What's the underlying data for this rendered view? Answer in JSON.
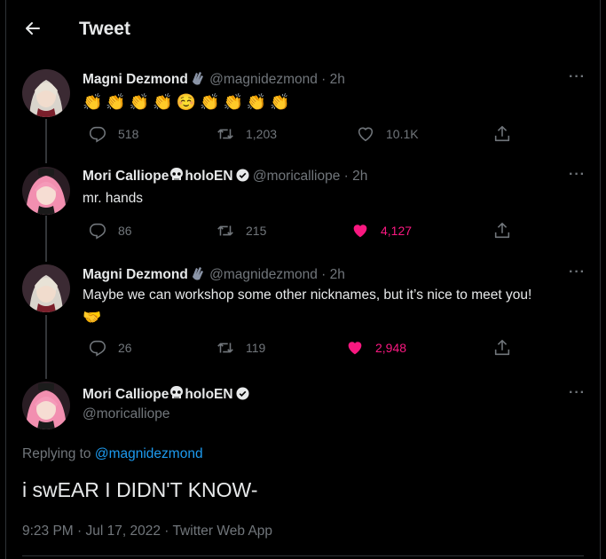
{
  "header": {
    "title": "Tweet"
  },
  "tweets": [
    {
      "display_name": "Magni Dezmond",
      "handle": "@magnidezmond",
      "sep": " · ",
      "time": "2h",
      "text": "👏👏👏👏☺️👏👏👏👏",
      "replies": "518",
      "retweets": "1,203",
      "likes": "10.1K",
      "liked": false
    },
    {
      "display_name": "Mori Calliope",
      "name_suffix": "holoEN",
      "handle": "@moricalliope",
      "sep": " · ",
      "time": "2h",
      "text": "mr. hands",
      "replies": "86",
      "retweets": "215",
      "likes": "4,127",
      "liked": true
    },
    {
      "display_name": "Magni Dezmond",
      "handle": "@magnidezmond",
      "sep": " · ",
      "time": "2h",
      "text": "Maybe we can workshop some other nicknames, but it’s nice to meet you!",
      "text_emoji": "🤝",
      "replies": "26",
      "retweets": "119",
      "likes": "2,948",
      "liked": true
    }
  ],
  "main_tweet": {
    "display_name": "Mori Calliope",
    "name_suffix": "holoEN",
    "handle": "@moricalliope",
    "replying_label": "Replying to ",
    "replying_to": "@magnidezmond",
    "text": "i swEAR I DIDN'T KNOW-",
    "timestamp": "9:23 PM · Jul 17, 2022 · Twitter Web App"
  },
  "more_label": "···",
  "colors": {
    "accent": "#1d9bf0",
    "like": "#f91880",
    "muted": "#71767b",
    "text": "#e7e9ea",
    "background": "#000000"
  },
  "icons": [
    "back-arrow-icon",
    "reply-icon",
    "retweet-icon",
    "like-icon",
    "share-icon",
    "verified-badge-icon",
    "skull-icon",
    "waving-hand-icon",
    "more-icon"
  ]
}
